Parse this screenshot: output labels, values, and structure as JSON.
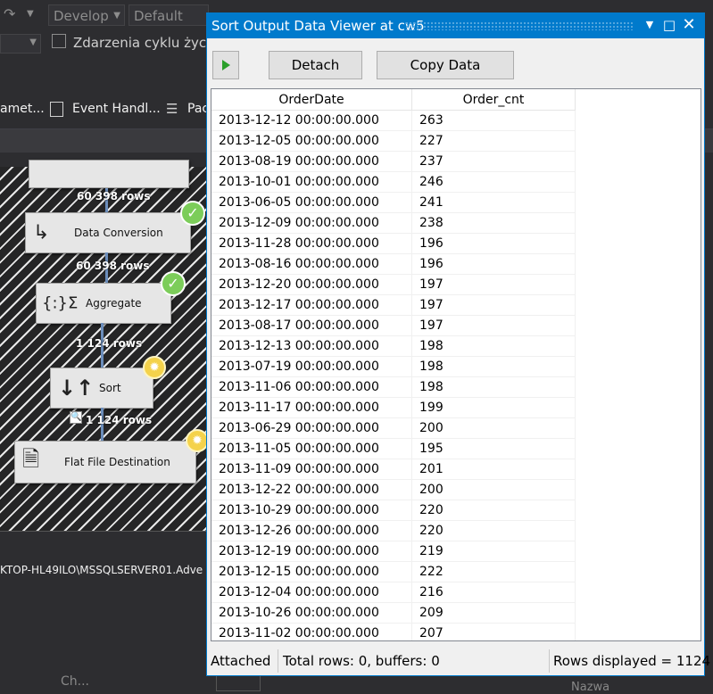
{
  "toolbar": {
    "solution_config": "Develop",
    "platform": "Default",
    "events_label": "Zdarzenia cyklu życia"
  },
  "tabs": [
    {
      "label": "amet..."
    },
    {
      "label": "Event Handl..."
    },
    {
      "label": "Pac"
    }
  ],
  "dataflow": {
    "rows_1": "60 398 rows",
    "node_conversion": "Data Conversion",
    "rows_2": "60 398 rows",
    "node_aggregate": "Aggregate",
    "rows_3": "1 124 rows",
    "node_sort": "Sort",
    "rows_4": "1 124 rows",
    "node_dest": "Flat File Destination"
  },
  "connection": {
    "text": "KTOP-HL49ILO\\MSSQLSERVER01.Adve"
  },
  "bottom": {
    "left_label": "Ch...",
    "right_label": "Nazwa"
  },
  "viewer": {
    "title": "Sort Output Data Viewer at cw5",
    "detach_label": "Detach",
    "copy_label": "Copy Data",
    "columns": [
      "OrderDate",
      "Order_cnt"
    ],
    "rows": [
      [
        "2013-12-12 00:00:00.000",
        "263"
      ],
      [
        "2013-12-05 00:00:00.000",
        "227"
      ],
      [
        "2013-08-19 00:00:00.000",
        "237"
      ],
      [
        "2013-10-01 00:00:00.000",
        "246"
      ],
      [
        "2013-06-05 00:00:00.000",
        "241"
      ],
      [
        "2013-12-09 00:00:00.000",
        "238"
      ],
      [
        "2013-11-28 00:00:00.000",
        "196"
      ],
      [
        "2013-08-16 00:00:00.000",
        "196"
      ],
      [
        "2013-12-20 00:00:00.000",
        "197"
      ],
      [
        "2013-12-17 00:00:00.000",
        "197"
      ],
      [
        "2013-08-17 00:00:00.000",
        "197"
      ],
      [
        "2013-12-13 00:00:00.000",
        "198"
      ],
      [
        "2013-07-19 00:00:00.000",
        "198"
      ],
      [
        "2013-11-06 00:00:00.000",
        "198"
      ],
      [
        "2013-11-17 00:00:00.000",
        "199"
      ],
      [
        "2013-06-29 00:00:00.000",
        "200"
      ],
      [
        "2013-11-05 00:00:00.000",
        "195"
      ],
      [
        "2013-11-09 00:00:00.000",
        "201"
      ],
      [
        "2013-12-22 00:00:00.000",
        "200"
      ],
      [
        "2013-10-29 00:00:00.000",
        "220"
      ],
      [
        "2013-12-26 00:00:00.000",
        "220"
      ],
      [
        "2013-12-19 00:00:00.000",
        "219"
      ],
      [
        "2013-12-15 00:00:00.000",
        "222"
      ],
      [
        "2013-12-04 00:00:00.000",
        "216"
      ],
      [
        "2013-10-26 00:00:00.000",
        "209"
      ],
      [
        "2013-11-02 00:00:00.000",
        "207"
      ]
    ],
    "status_attached": "Attached",
    "status_totals": "Total rows: 0, buffers: 0",
    "status_displayed": "Rows displayed = 1124"
  }
}
